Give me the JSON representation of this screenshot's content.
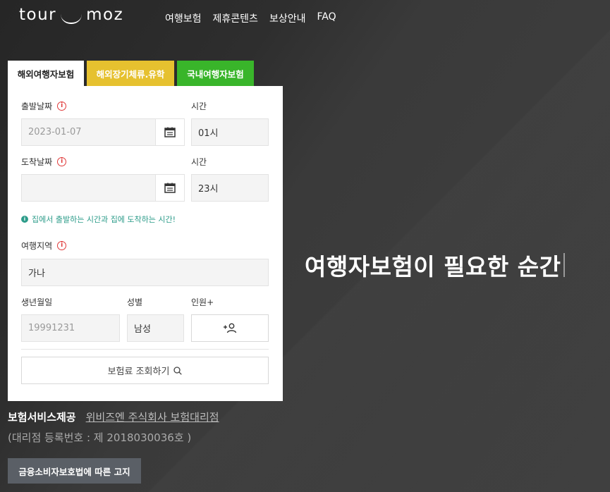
{
  "header": {
    "logo_left": "tour",
    "logo_right": "moz",
    "nav": [
      "여행보험",
      "제휴콘텐츠",
      "보상안내",
      "FAQ"
    ]
  },
  "tabs": [
    "해외여행자보험",
    "해외장기체류.유학",
    "국내여행자보험"
  ],
  "form": {
    "departure_label": "출발날짜",
    "departure_value": "2023-01-07",
    "departure_time_label": "시간",
    "departure_time": "01시",
    "arrival_label": "도착날짜",
    "arrival_value": "",
    "arrival_time_label": "시간",
    "arrival_time": "23시",
    "notice": "집에서 출발하는 시간과 집에 도착하는 시간!",
    "region_label": "여행지역",
    "region_value": "가나",
    "birth_label": "생년월일",
    "birth_placeholder": "19991231",
    "gender_label": "성별",
    "gender_value": "남성",
    "people_label": "인원+",
    "search_label": "보험료 조회하기"
  },
  "hero_text": "여행자보험이 필요한 순간",
  "footer": {
    "provider_label": "보험서비스제공",
    "provider_link": "위비즈엔 주식회사 보험대리점",
    "registration": "(대리점 등록번호 : 제 2018030036호 )",
    "notice_button": "금융소비자보호법에 따른 고지"
  },
  "colors": {
    "tab_longstay": "#e6c12f",
    "tab_domestic": "#39b52a",
    "notice": "#2d9c8a",
    "info_icon": "#e03a3a"
  }
}
